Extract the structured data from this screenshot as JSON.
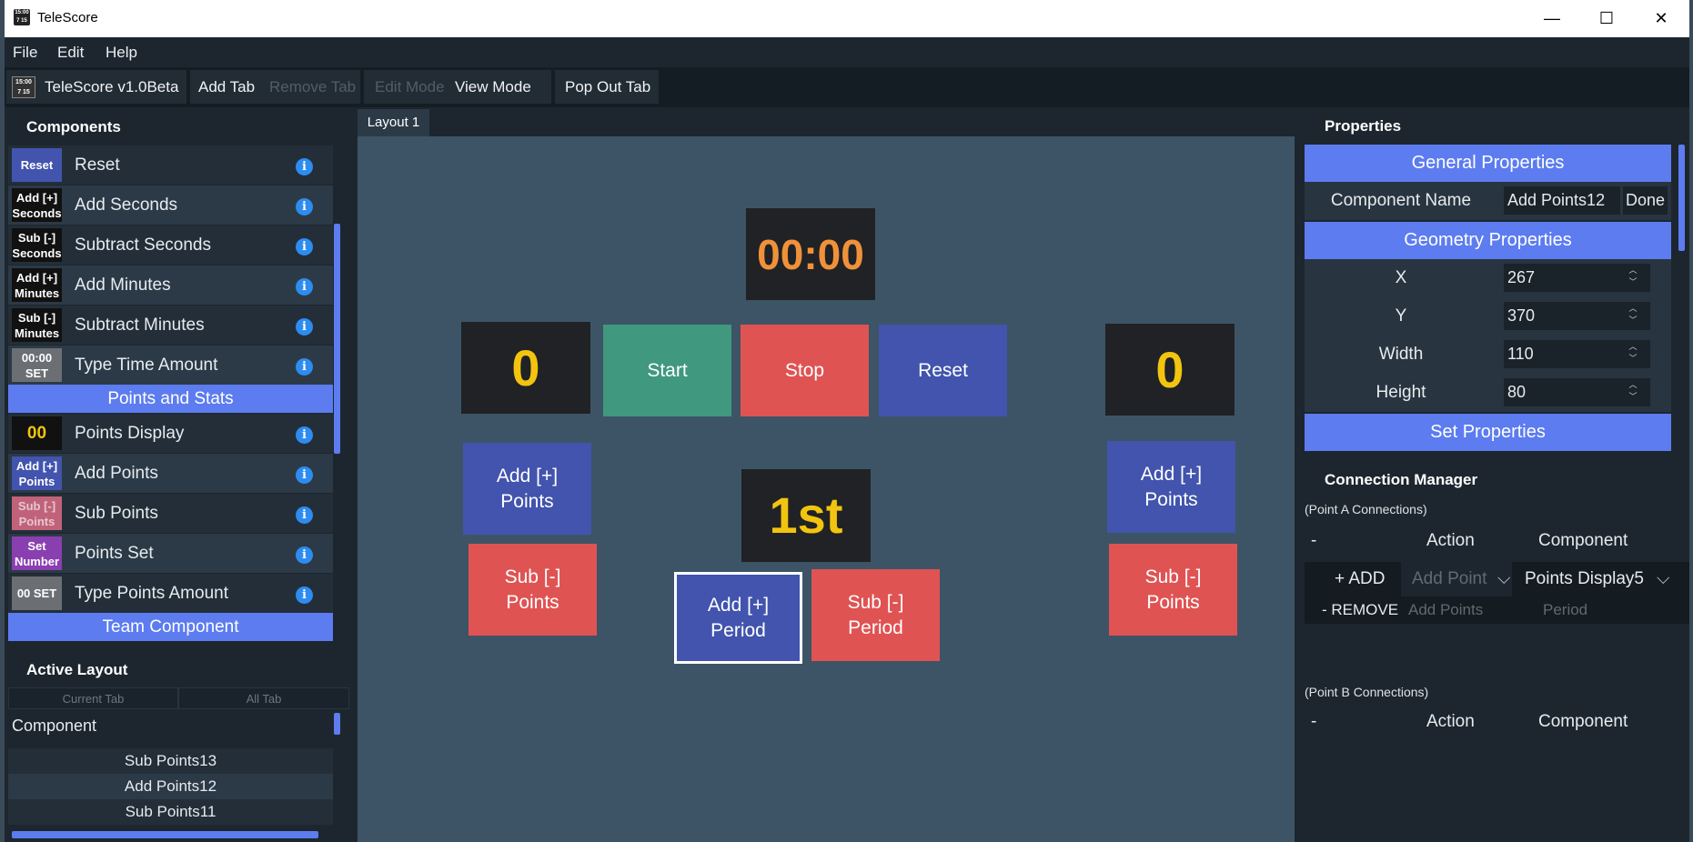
{
  "window": {
    "title": "TeleScore",
    "controls": [
      "—",
      "☐",
      "✕"
    ]
  },
  "menu": [
    "File",
    "Edit",
    "Help"
  ],
  "toolbar": {
    "app_label": "TeleScore v1.0Beta",
    "add_tab": "Add Tab",
    "remove_tab": "Remove Tab",
    "edit_mode": "Edit Mode",
    "view_mode": "View Mode",
    "pop_out_tab": "Pop Out Tab"
  },
  "components_panel": {
    "title": "Components",
    "items": [
      {
        "icon_text": "Reset",
        "label": "Reset",
        "icon_color": "#4254ad"
      },
      {
        "icon_text": "Add [+] Seconds",
        "label": "Add Seconds",
        "icon_color": "#1a1a1a"
      },
      {
        "icon_text": "Sub [-] Seconds",
        "label": "Subtract Seconds",
        "icon_color": "#1a1a1a"
      },
      {
        "icon_text": "Add [+] Minutes",
        "label": "Add Minutes",
        "icon_color": "#1a1a1a"
      },
      {
        "icon_text": "Sub [-] Minutes",
        "label": "Subtract Minutes",
        "icon_color": "#1a1a1a"
      },
      {
        "icon_text": "00:00 SET",
        "label": "Type Time Amount",
        "icon_color": "#6b6f74"
      }
    ],
    "section_points": "Points and Stats",
    "points_items": [
      {
        "icon_text": "00",
        "label": "Points Display",
        "icon_color": "#1a1a1a"
      },
      {
        "icon_text": "Add [+] Points",
        "label": "Add Points",
        "icon_color": "#4254ad"
      },
      {
        "icon_text": "Sub [-] Points",
        "label": "Sub Points",
        "icon_color": "#c0637a"
      },
      {
        "icon_text": "Set Number",
        "label": "Points Set",
        "icon_color": "#8a3fb0"
      },
      {
        "icon_text": "00 SET",
        "label": "Type Points Amount",
        "icon_color": "#6b6f74"
      }
    ],
    "section_team": "Team Component",
    "info_glyph": "i"
  },
  "active_layout": {
    "title": "Active Layout",
    "tabs": [
      "Current Tab",
      "All Tab"
    ],
    "header": "Component",
    "rows": [
      "Sub Points13",
      "Add Points12",
      "Sub Points11"
    ]
  },
  "canvas": {
    "tab_label": "Layout 1",
    "timer": "00:00",
    "left_score": "0",
    "right_score": "0",
    "period": "1st",
    "start": "Start",
    "stop": "Stop",
    "reset": "Reset",
    "add_points": "Add [+]\nPoints",
    "sub_points": "Sub [-]\nPoints",
    "add_period": "Add [+]\nPeriod",
    "sub_period": "Sub [-]\nPeriod"
  },
  "properties": {
    "title": "Properties",
    "general_section": "General Properties",
    "component_name_label": "Component Name",
    "component_name_value": "Add Points12",
    "done": "Done",
    "geometry_section": "Geometry Properties",
    "fields": [
      {
        "label": "X",
        "value": "267"
      },
      {
        "label": "Y",
        "value": "370"
      },
      {
        "label": "Width",
        "value": "110"
      },
      {
        "label": "Height",
        "value": "80"
      }
    ],
    "set_section": "Set Properties"
  },
  "connection_manager": {
    "title": "Connection Manager",
    "point_a": "(Point A Connections)",
    "point_b": "(Point B Connections)",
    "col_dash": "-",
    "col_action": "Action",
    "col_component": "Component",
    "add": "+ ADD",
    "remove": "- REMOVE",
    "action_select": "Add Point",
    "component_select": "Points Display5",
    "action_placeholder": "Add Points",
    "component_placeholder": "Period"
  },
  "colors": {
    "accent": "#5c7cf0",
    "timer": "#f0913a",
    "score": "#f2c40f",
    "green": "#40987f",
    "red": "#e05353",
    "blue": "#4254ad"
  }
}
